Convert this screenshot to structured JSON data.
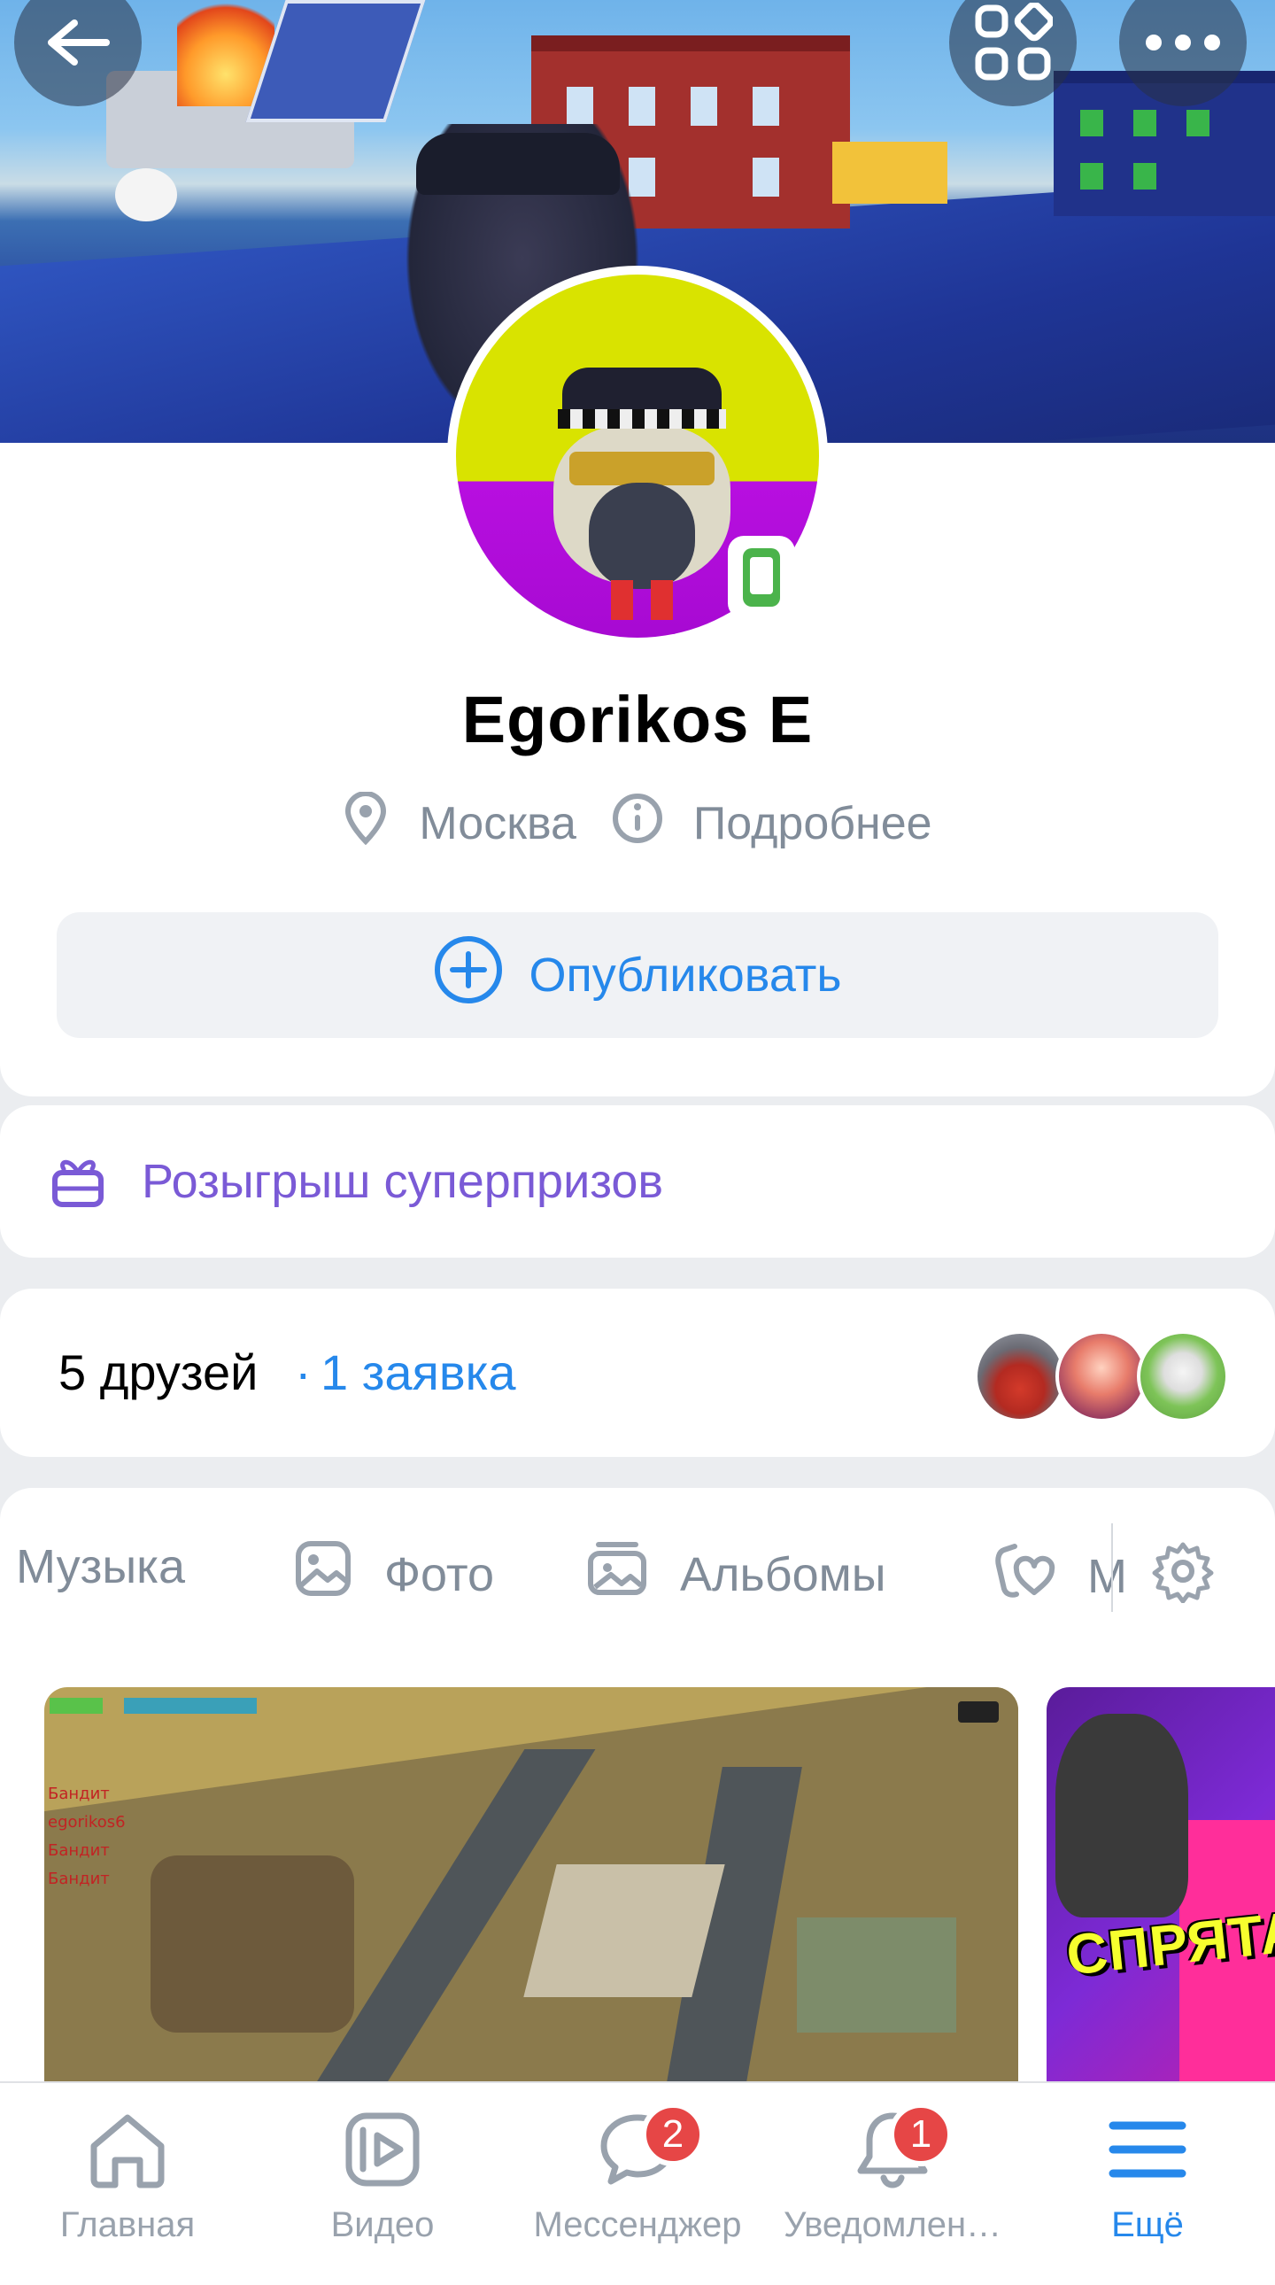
{
  "header": {
    "back_icon": "arrow-left-icon",
    "services_icon": "services-grid-icon",
    "more_icon": "more-horizontal-icon"
  },
  "profile": {
    "name": "Egorikos E",
    "city": "Москва",
    "details_label": "Подробнее",
    "online_status_icon": "mobile-online-icon",
    "publish_label": "Опубликовать"
  },
  "promo": {
    "label": "Розыгрыш суперпризов",
    "icon": "gift-icon"
  },
  "friends": {
    "count_label": "5 друзей",
    "separator": "·",
    "requests_label": "1 заявка"
  },
  "media_tabs": {
    "items": [
      {
        "label": "Музыка",
        "icon": "music-icon"
      },
      {
        "label": "Фото",
        "icon": "photo-icon"
      },
      {
        "label": "Альбомы",
        "icon": "albums-icon"
      },
      {
        "label": "М",
        "icon": "wishlist-icon"
      }
    ],
    "settings_icon": "gear-icon"
  },
  "videos": {
    "thumb1_names": [
      "Бандит",
      "egorikos6",
      "Бандит",
      "Бандит"
    ],
    "thumb2_caption": "СПРЯТАТ"
  },
  "tabbar": {
    "items": [
      {
        "label": "Главная",
        "icon": "home-icon",
        "badge": ""
      },
      {
        "label": "Видео",
        "icon": "video-icon",
        "badge": ""
      },
      {
        "label": "Мессенджер",
        "icon": "messenger-icon",
        "badge": "2"
      },
      {
        "label": "Уведомлен…",
        "icon": "bell-icon",
        "badge": "1"
      },
      {
        "label": "Ещё",
        "icon": "menu-icon",
        "badge": ""
      }
    ],
    "active": "Ещё"
  },
  "colors": {
    "accent": "#2688eb",
    "secondary_text": "#818c99",
    "promo": "#7a5ad6",
    "badge": "#e64646",
    "online": "#4bb34b",
    "background": "#ebedf0"
  }
}
